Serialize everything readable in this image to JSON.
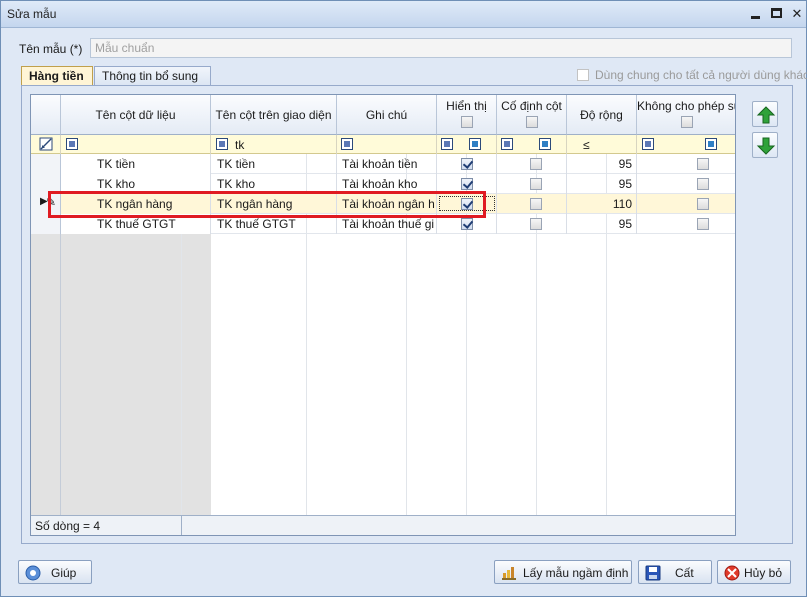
{
  "window": {
    "title": "Sửa mẫu"
  },
  "form": {
    "name_label": "Tên mẫu (*)",
    "name_value": "Mẫu chuẩn"
  },
  "tabs": [
    {
      "label": "Hàng tiền",
      "active": true
    },
    {
      "label": "Thông tin bổ sung",
      "active": false
    }
  ],
  "shared_checkbox": {
    "label": "Dùng chung cho tất cả người dùng khác",
    "checked": false
  },
  "grid": {
    "columns": {
      "data_col": "Tên cột dữ liệu",
      "ui_col": "Tên cột trên giao diện",
      "note": "Ghi chú",
      "visible": "Hiển thị",
      "fixed": "Cố định cột",
      "width": "Độ rộng",
      "readonly": "Không cho phép sửa"
    },
    "filter": {
      "ui_col": "tk",
      "width_op": "≤"
    },
    "rows": [
      {
        "data_col": "TK tiền",
        "ui_col": "TK tiền",
        "note": "Tài khoản tiền",
        "visible": true,
        "fixed": false,
        "width": "95",
        "readonly": false
      },
      {
        "data_col": "TK kho",
        "ui_col": "TK kho",
        "note": "Tài khoản kho",
        "visible": true,
        "fixed": false,
        "width": "95",
        "readonly": false
      },
      {
        "data_col": "TK ngân hàng",
        "ui_col": "TK ngân hàng",
        "note": "Tài khoản ngân h",
        "visible": true,
        "fixed": false,
        "width": "110",
        "readonly": false
      },
      {
        "data_col": "TK thuế GTGT",
        "ui_col": "TK thuế GTGT",
        "note": "Tài khoản thuế gi",
        "visible": true,
        "fixed": false,
        "width": "95",
        "readonly": false
      }
    ],
    "selected_row_index": 2,
    "footer": "Số dòng = 4"
  },
  "buttons": {
    "help": "Giúp",
    "default_template": "Lấy mẫu ngầm định",
    "save": "Cất",
    "cancel": "Hủy bỏ"
  },
  "colors": {
    "highlight": "#e01b22",
    "selected_row": "#fff7d8",
    "filter_row": "#fffbd9",
    "arrow_green": "#1f9a2a"
  }
}
